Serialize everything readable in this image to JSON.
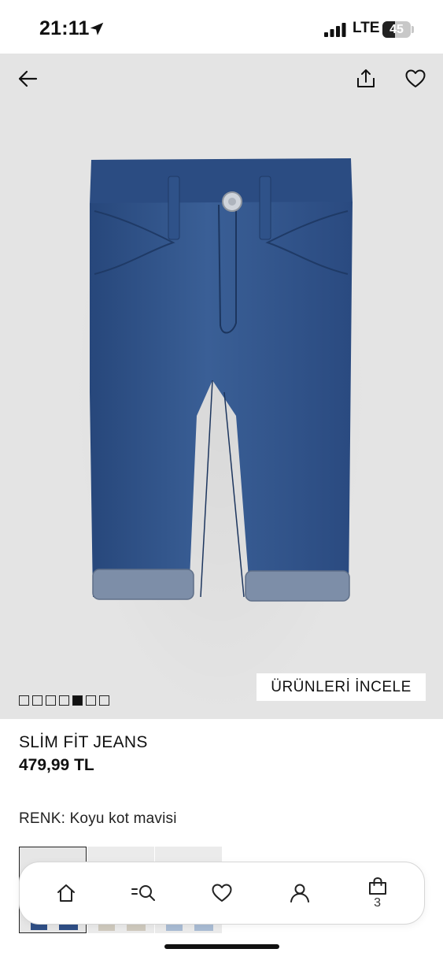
{
  "status_bar": {
    "time": "21:11",
    "network": "LTE",
    "battery_level": "45",
    "battery_fraction": 0.45
  },
  "header": {
    "back_icon": "arrow-left-icon",
    "share_icon": "share-icon",
    "favorite_icon": "heart-icon"
  },
  "gallery": {
    "image_count": 7,
    "active_index": 4,
    "explore_label": "ÜRÜNLERİ İNCELE"
  },
  "product": {
    "name": "SLİM FİT JEANS",
    "price": "479,99 TL",
    "color_label": "RENK:",
    "color_value": "Koyu kot mavisi"
  },
  "swatches": {
    "selected_index": 0,
    "colors": [
      "#2f4f86",
      "#cfcabe",
      "#a9bcd4"
    ]
  },
  "bottom_nav": {
    "items": [
      {
        "name": "home",
        "icon": "home-icon"
      },
      {
        "name": "search",
        "icon": "search-icon"
      },
      {
        "name": "favorites",
        "icon": "heart-icon"
      },
      {
        "name": "account",
        "icon": "user-icon"
      },
      {
        "name": "bag",
        "icon": "shopping-bag-icon"
      }
    ],
    "bag_count": "3"
  },
  "colors": {
    "hero_background": "#e4e4e4",
    "denim": "#2d4f85",
    "denim_dark": "#1f3a66",
    "cuff": "#7d8ea8"
  }
}
